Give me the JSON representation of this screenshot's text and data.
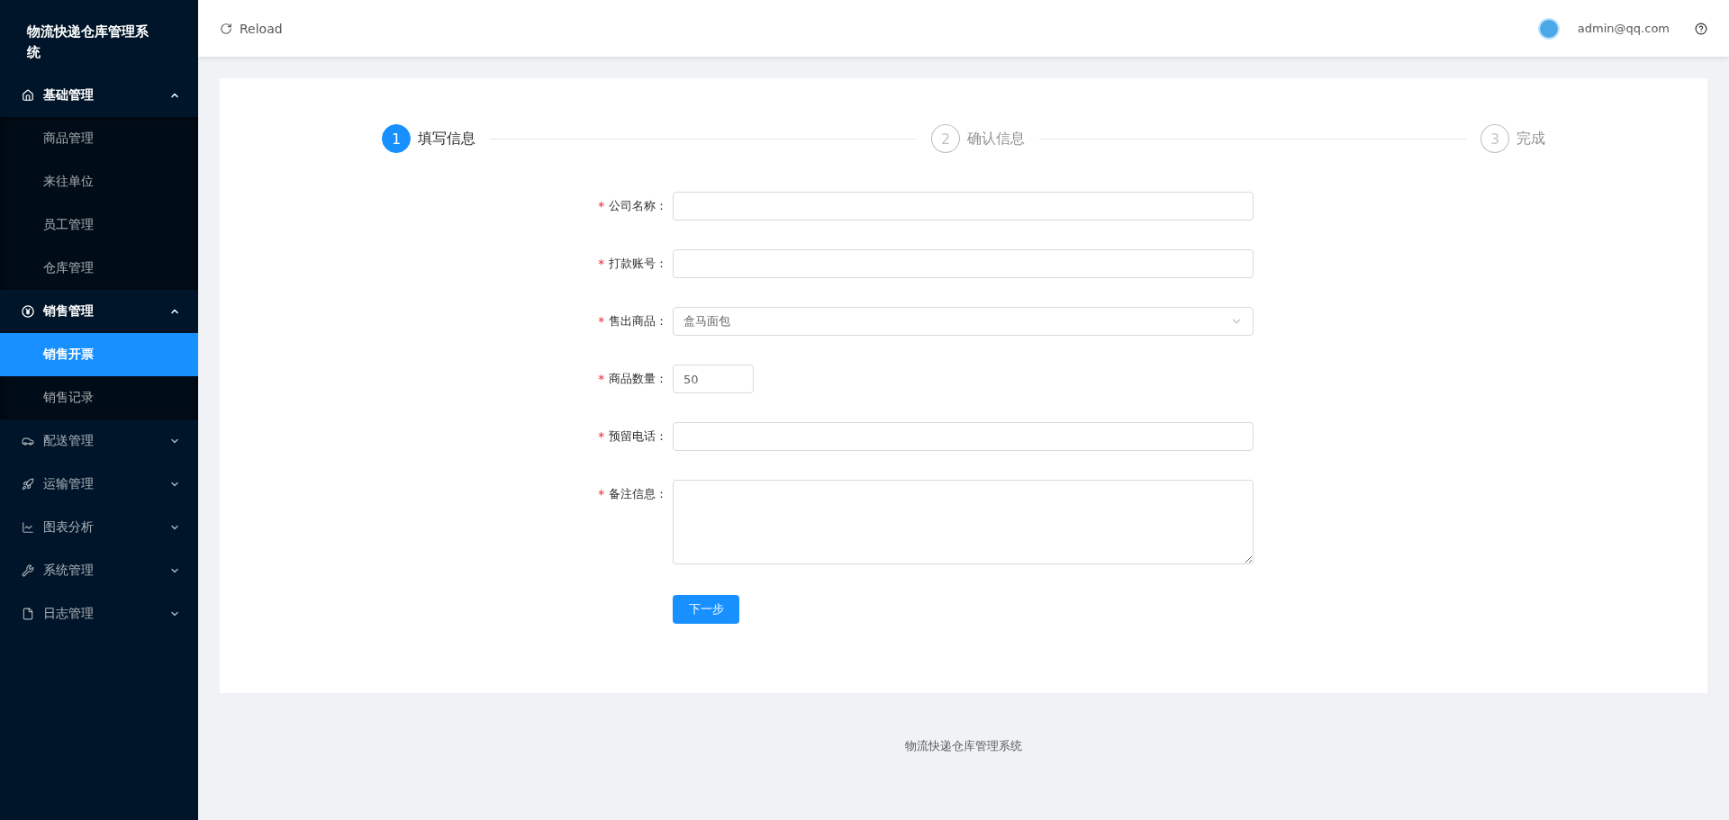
{
  "sidebar": {
    "title": "物流快递仓库管理系统",
    "menus": [
      {
        "label": "基础管理",
        "expanded": true,
        "children": [
          {
            "label": "商品管理",
            "selected": false
          },
          {
            "label": "来往单位",
            "selected": false
          },
          {
            "label": "员工管理",
            "selected": false
          },
          {
            "label": "仓库管理",
            "selected": false
          }
        ]
      },
      {
        "label": "销售管理",
        "expanded": true,
        "children": [
          {
            "label": "销售开票",
            "selected": true
          },
          {
            "label": "销售记录",
            "selected": false
          }
        ]
      },
      {
        "label": "配送管理",
        "expanded": false
      },
      {
        "label": "运输管理",
        "expanded": false
      },
      {
        "label": "图表分析",
        "expanded": false
      },
      {
        "label": "系统管理",
        "expanded": false
      },
      {
        "label": "日志管理",
        "expanded": false
      }
    ]
  },
  "header": {
    "reload": "Reload",
    "user": "admin@qq.com"
  },
  "steps": [
    {
      "number": "1",
      "label": "填写信息",
      "selected": true
    },
    {
      "number": "2",
      "label": "确认信息",
      "selected": false
    },
    {
      "number": "3",
      "label": "完成",
      "selected": false
    }
  ],
  "form": {
    "fields": [
      {
        "kind": "input",
        "label": "公司名称：",
        "required_mark": "*"
      },
      {
        "kind": "input",
        "label": "打款账号：",
        "required_mark": "*"
      },
      {
        "kind": "select",
        "label": "售出商品：",
        "required_mark": "*",
        "value": "盒马面包"
      },
      {
        "kind": "number",
        "label": "商品数量：",
        "required_mark": "*",
        "value": "50"
      },
      {
        "kind": "input",
        "label": "预留电话：",
        "required_mark": "*"
      },
      {
        "kind": "textarea",
        "label": "备注信息：",
        "required_mark": "*"
      }
    ],
    "submit": "下一步"
  },
  "footer": "物流快递仓库管理系统"
}
